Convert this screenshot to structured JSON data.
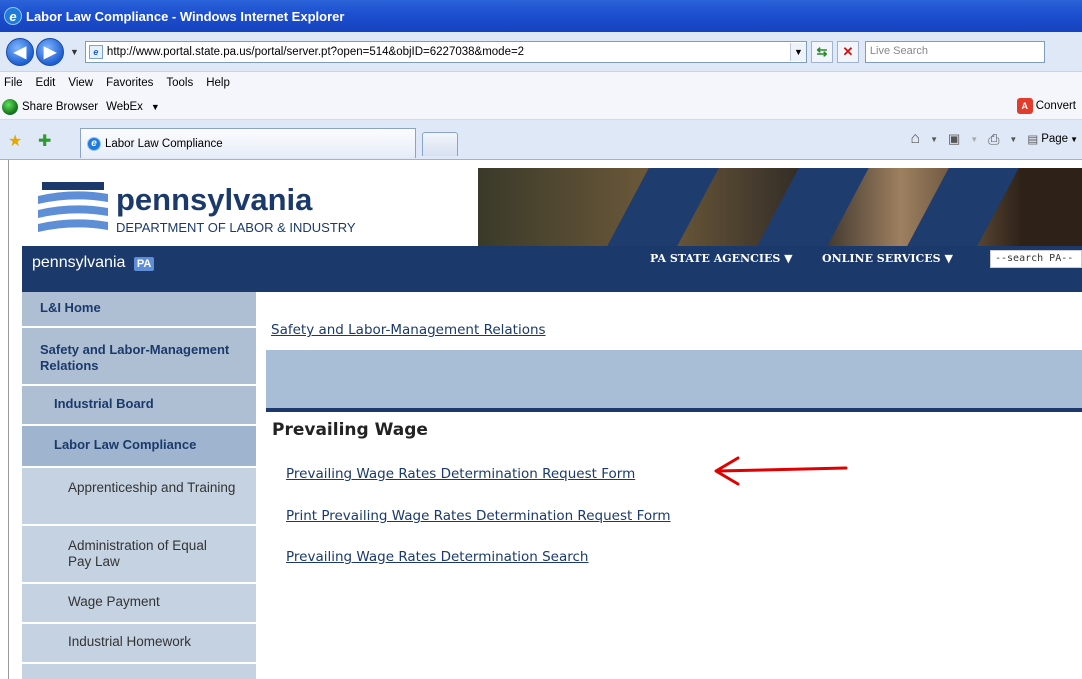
{
  "window": {
    "title": "Labor Law Compliance - Windows Internet Explorer"
  },
  "address_bar": {
    "url": "http://www.portal.state.pa.us/portal/server.pt?open=514&objID=6227038&mode=2",
    "search_placeholder": "Live Search"
  },
  "menu": {
    "items": [
      "File",
      "Edit",
      "View",
      "Favorites",
      "Tools",
      "Help"
    ]
  },
  "links_bar": {
    "share_browser": "Share Browser",
    "webex": "WebEx",
    "convert": "Convert"
  },
  "tabs": {
    "active_tab": "Labor Law Compliance",
    "page_menu": "Page"
  },
  "site": {
    "logo_title": "pennsylvania",
    "logo_subtitle": "DEPARTMENT OF LABOR & INDUSTRY",
    "brand": "pennsylvania",
    "brand_badge": "PA",
    "nav_agencies": "PA STATE AGENCIES",
    "nav_online": "ONLINE SERVICES",
    "search_value": "--search PA--"
  },
  "leftnav": {
    "home": "L&I Home",
    "safety": "Safety and Labor-Management Relations",
    "industrial_board": "Industrial Board",
    "labor_law": "Labor Law Compliance",
    "apprenticeship": "Apprenticeship and Training",
    "equal_pay": "Administration of Equal Pay Law",
    "wage_payment": "Wage Payment",
    "homework": "Industrial Homework"
  },
  "main": {
    "breadcrumb": "Safety and Labor-Management Relations",
    "section_title": "Prevailing Wage",
    "links": [
      "Prevailing Wage Rates Determination Request Form",
      "Print Prevailing Wage Rates Determination Request Form",
      "Prevailing Wage Rates Determination Search"
    ]
  },
  "colors": {
    "title_bar": "#1c4fcf",
    "site_navy": "#1b3a6b",
    "annotation_arrow": "#e00000"
  }
}
